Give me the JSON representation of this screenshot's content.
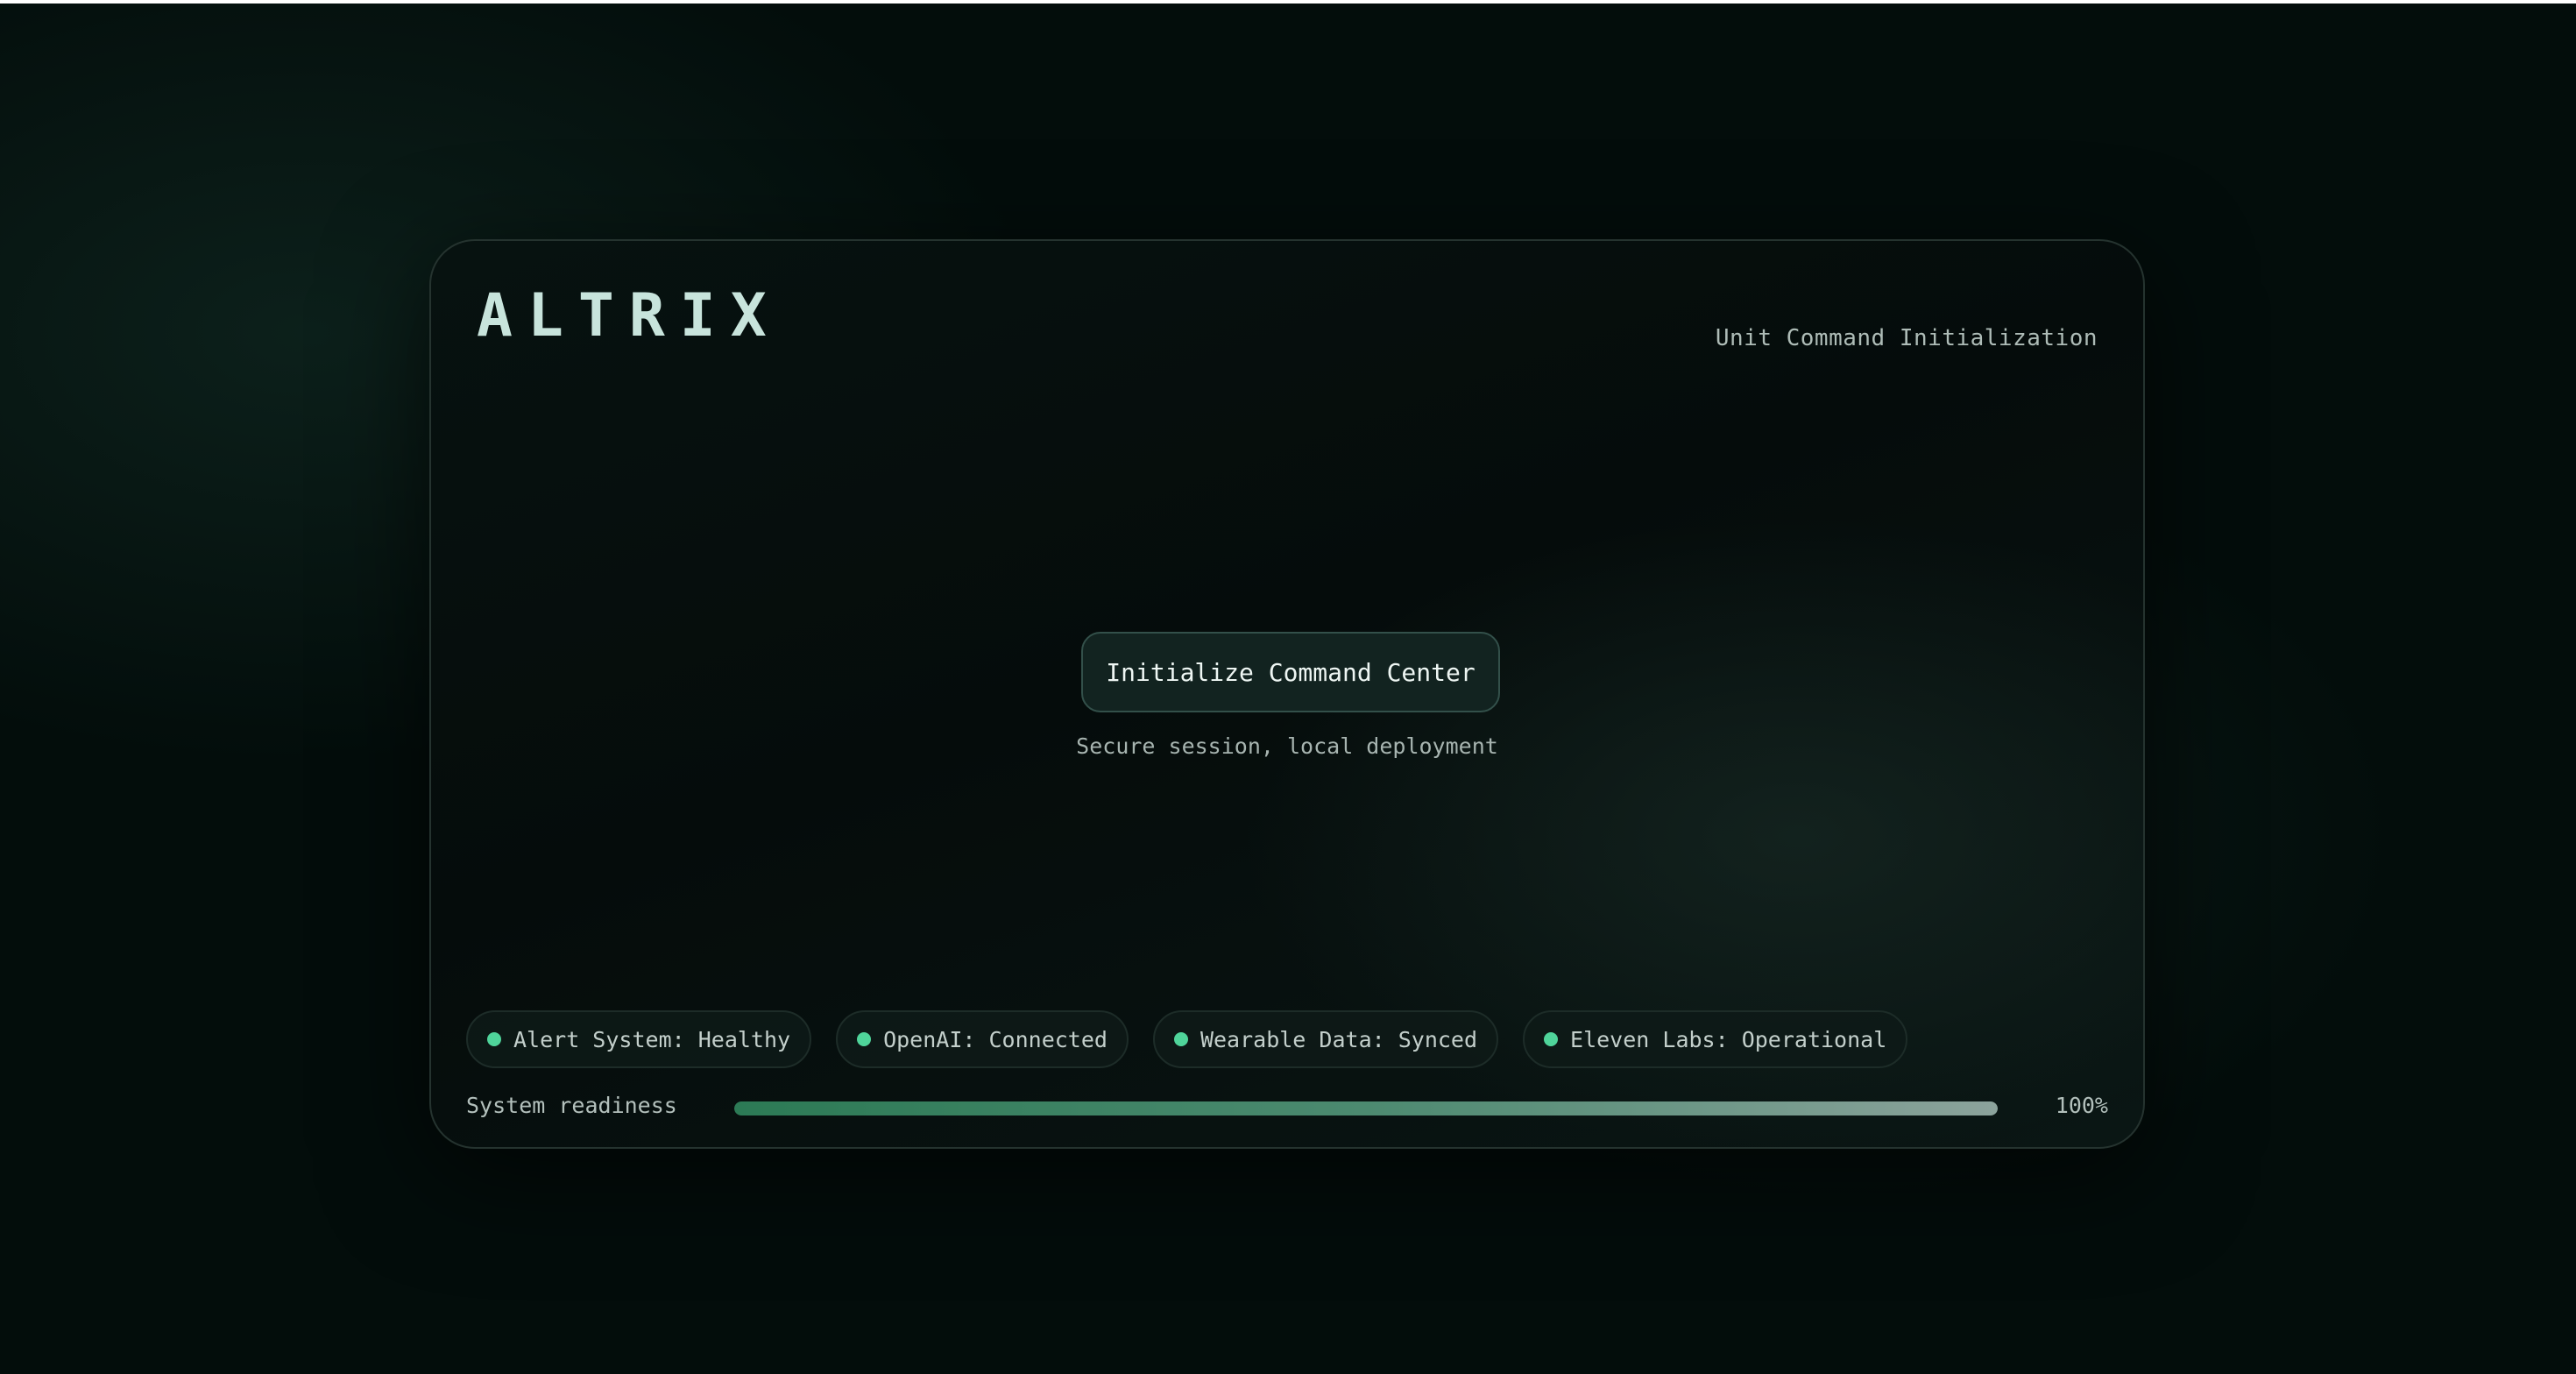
{
  "app": {
    "brand": "ALTRIX",
    "subtitle": "Unit Command Initialization"
  },
  "main": {
    "init_button_label": "Initialize Command Center",
    "session_note": "Secure session, local deployment"
  },
  "status": {
    "items": [
      {
        "label": "Alert System: Healthy",
        "state_color": "#4fd49a"
      },
      {
        "label": "OpenAI: Connected",
        "state_color": "#4fd49a"
      },
      {
        "label": "Wearable Data: Synced",
        "state_color": "#4fd49a"
      },
      {
        "label": "Eleven Labs: Operational",
        "state_color": "#4fd49a"
      }
    ]
  },
  "readiness": {
    "label": "System readiness",
    "value_text": "100%",
    "fraction": 1.0
  },
  "colors": {
    "accent": "#4fd49a",
    "background": "#030d0b",
    "brand_text": "#c8e4dc"
  }
}
